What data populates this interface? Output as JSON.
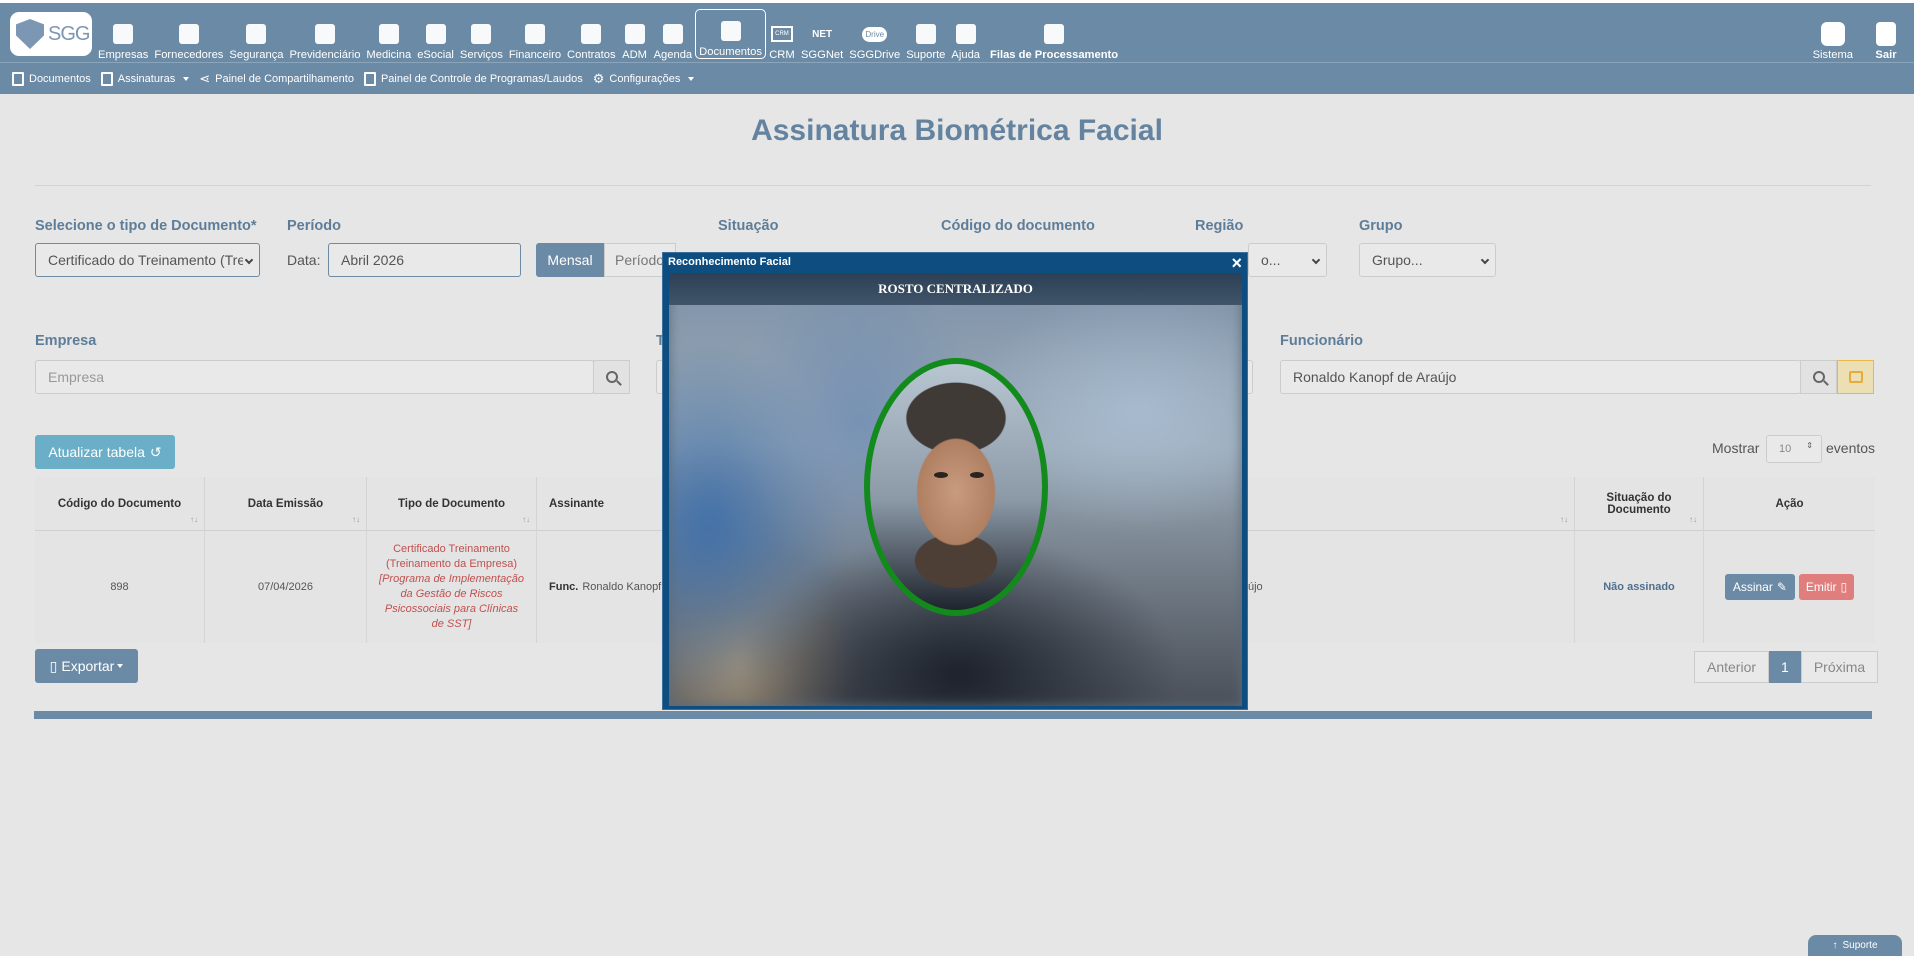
{
  "brand": {
    "logo_text": "SGG"
  },
  "nav": [
    {
      "label": "Empresas",
      "icon": "building-icon"
    },
    {
      "label": "Fornecedores",
      "icon": "truck-icon"
    },
    {
      "label": "Segurança",
      "icon": "helmet-icon"
    },
    {
      "label": "Previdenciário",
      "icon": "handshake-icon"
    },
    {
      "label": "Medicina",
      "icon": "stethoscope-icon"
    },
    {
      "label": "eSocial",
      "icon": "esocial-icon"
    },
    {
      "label": "Serviços",
      "icon": "layers-icon"
    },
    {
      "label": "Financeiro",
      "icon": "money-bag-icon"
    },
    {
      "label": "Contratos",
      "icon": "contract-icon"
    },
    {
      "label": "ADM",
      "icon": "folder-users-icon"
    },
    {
      "label": "Agenda",
      "icon": "calendar-icon"
    },
    {
      "label": "Documentos",
      "icon": "document-icon"
    },
    {
      "label": "CRM",
      "icon": "crm-icon"
    },
    {
      "label": "SGGNet",
      "icon": "net-icon"
    },
    {
      "label": "SGGDrive",
      "icon": "cloud-icon"
    },
    {
      "label": "Suporte",
      "icon": "headset-icon"
    },
    {
      "label": "Ajuda",
      "icon": "help-bubble-icon"
    },
    {
      "label": "Filas de Processamento",
      "icon": "queue-icon"
    }
  ],
  "nav_badges": {
    "crm_box": "CRM",
    "net_text": "NET",
    "drive_text": "Drive"
  },
  "right_nav": [
    {
      "label": "Sistema",
      "icon": "system-gear-icon"
    },
    {
      "label": "Sair",
      "icon": "exit-icon"
    }
  ],
  "subnav": {
    "documentos": "Documentos",
    "assinaturas": "Assinaturas",
    "compartilhamento": "Painel de Compartilhamento",
    "controle": "Painel de Controle de Programas/Laudos",
    "configuracoes": "Configurações"
  },
  "page_title": "Assinatura Biométrica Facial",
  "filters": {
    "tipo_label": "Selecione o tipo de Documento*",
    "tipo_value": "Certificado do Treinamento (Tre",
    "periodo_label": "Período",
    "data_label": "Data:",
    "data_value": "Abril 2026",
    "mensal_label": "Mensal",
    "periodo_btn": "Período",
    "situacao_label": "Situação",
    "codigo_label": "Código do documento",
    "regiao_label": "Região",
    "regiao_value": "o...",
    "grupo_label": "Grupo",
    "grupo_value": "Grupo...",
    "empresa_label": "Empresa",
    "empresa_placeholder": "Empresa",
    "t_label": "T",
    "funcionario_label": "Funcionário",
    "funcionario_value": "Ronaldo Kanopf de Araújo"
  },
  "atualizar_label": "Atualizar tabela",
  "mostrar": {
    "label": "Mostrar",
    "value": "10",
    "suffix": "eventos"
  },
  "table": {
    "headers": [
      "Código do Documento",
      "Data Emissão",
      "Tipo de Documento",
      "Assinante",
      "Situação do Documento",
      "Ação"
    ],
    "row": {
      "codigo": "898",
      "data": "07/04/2026",
      "tipo_line1": "Certificado Treinamento (Treinamento da Empresa)",
      "tipo_line2": "[Programa de Implementação da Gestão de Riscos Psicossociais para Clínicas de SST]",
      "assinante_prefix": "Func.",
      "assinante": "Ronaldo Kanopf d",
      "assinante_tail": "újo",
      "situacao": "Não assinado",
      "assinar": "Assinar",
      "emitir": "Emitir"
    }
  },
  "exportar_label": "Exportar",
  "pagination": {
    "prev": "Anterior",
    "current": "1",
    "next": "Próxima"
  },
  "modal": {
    "title": "Reconhecimento Facial",
    "close": "×",
    "status": "ROSTO CENTRALIZADO"
  },
  "support_tab": "Suporte",
  "colors": {
    "primary": "#6b8aa5",
    "title": "#6483a0",
    "success_oval": "#138a1c",
    "danger": "#e07d7d",
    "modal": "#0e4d80"
  }
}
